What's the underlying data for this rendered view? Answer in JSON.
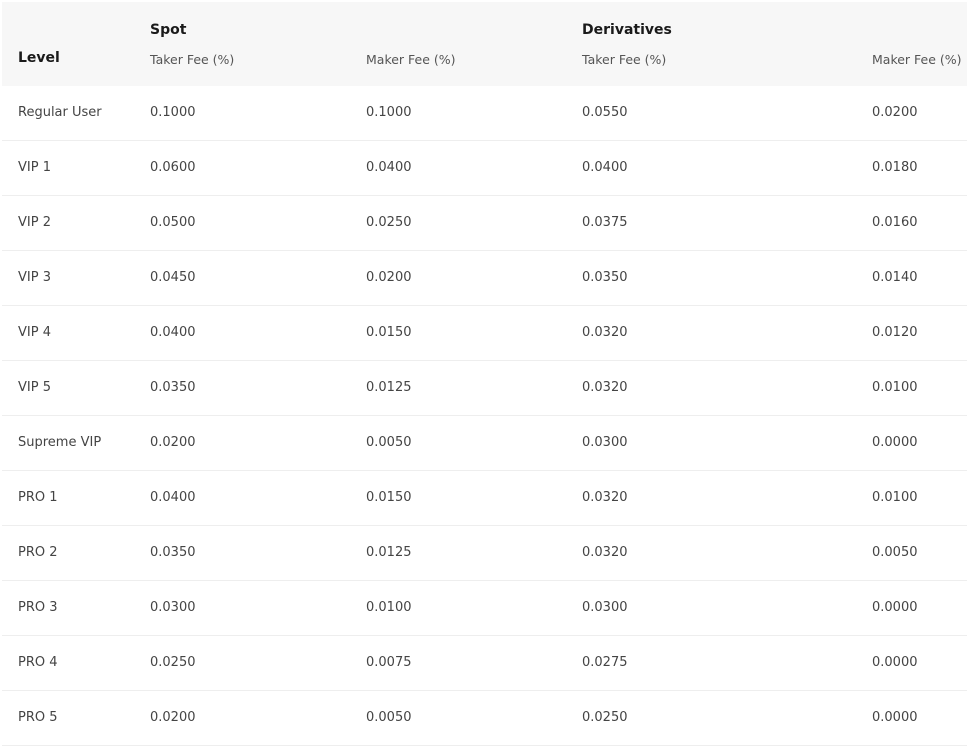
{
  "header": {
    "level": "Level",
    "groups": {
      "spot": "Spot",
      "derivatives": "Derivatives"
    },
    "columns": {
      "spot_taker": "Taker Fee (%)",
      "spot_maker": "Maker Fee (%)",
      "deriv_taker": "Taker Fee (%)",
      "deriv_maker": "Maker Fee (%)"
    }
  },
  "rows": [
    {
      "level": "Regular User",
      "spot_taker": "0.1000",
      "spot_maker": "0.1000",
      "deriv_taker": "0.0550",
      "deriv_maker": "0.0200"
    },
    {
      "level": "VIP 1",
      "spot_taker": "0.0600",
      "spot_maker": "0.0400",
      "deriv_taker": "0.0400",
      "deriv_maker": "0.0180"
    },
    {
      "level": "VIP 2",
      "spot_taker": "0.0500",
      "spot_maker": "0.0250",
      "deriv_taker": "0.0375",
      "deriv_maker": "0.0160"
    },
    {
      "level": "VIP 3",
      "spot_taker": "0.0450",
      "spot_maker": "0.0200",
      "deriv_taker": "0.0350",
      "deriv_maker": "0.0140"
    },
    {
      "level": "VIP 4",
      "spot_taker": "0.0400",
      "spot_maker": "0.0150",
      "deriv_taker": "0.0320",
      "deriv_maker": "0.0120"
    },
    {
      "level": "VIP 5",
      "spot_taker": "0.0350",
      "spot_maker": "0.0125",
      "deriv_taker": "0.0320",
      "deriv_maker": "0.0100"
    },
    {
      "level": "Supreme VIP",
      "spot_taker": "0.0200",
      "spot_maker": "0.0050",
      "deriv_taker": "0.0300",
      "deriv_maker": "0.0000"
    },
    {
      "level": "PRO 1",
      "spot_taker": "0.0400",
      "spot_maker": "0.0150",
      "deriv_taker": "0.0320",
      "deriv_maker": "0.0100"
    },
    {
      "level": "PRO 2",
      "spot_taker": "0.0350",
      "spot_maker": "0.0125",
      "deriv_taker": "0.0320",
      "deriv_maker": "0.0050"
    },
    {
      "level": "PRO 3",
      "spot_taker": "0.0300",
      "spot_maker": "0.0100",
      "deriv_taker": "0.0300",
      "deriv_maker": "0.0000"
    },
    {
      "level": "PRO 4",
      "spot_taker": "0.0250",
      "spot_maker": "0.0075",
      "deriv_taker": "0.0275",
      "deriv_maker": "0.0000"
    },
    {
      "level": "PRO 5",
      "spot_taker": "0.0200",
      "spot_maker": "0.0050",
      "deriv_taker": "0.0250",
      "deriv_maker": "0.0000"
    }
  ]
}
